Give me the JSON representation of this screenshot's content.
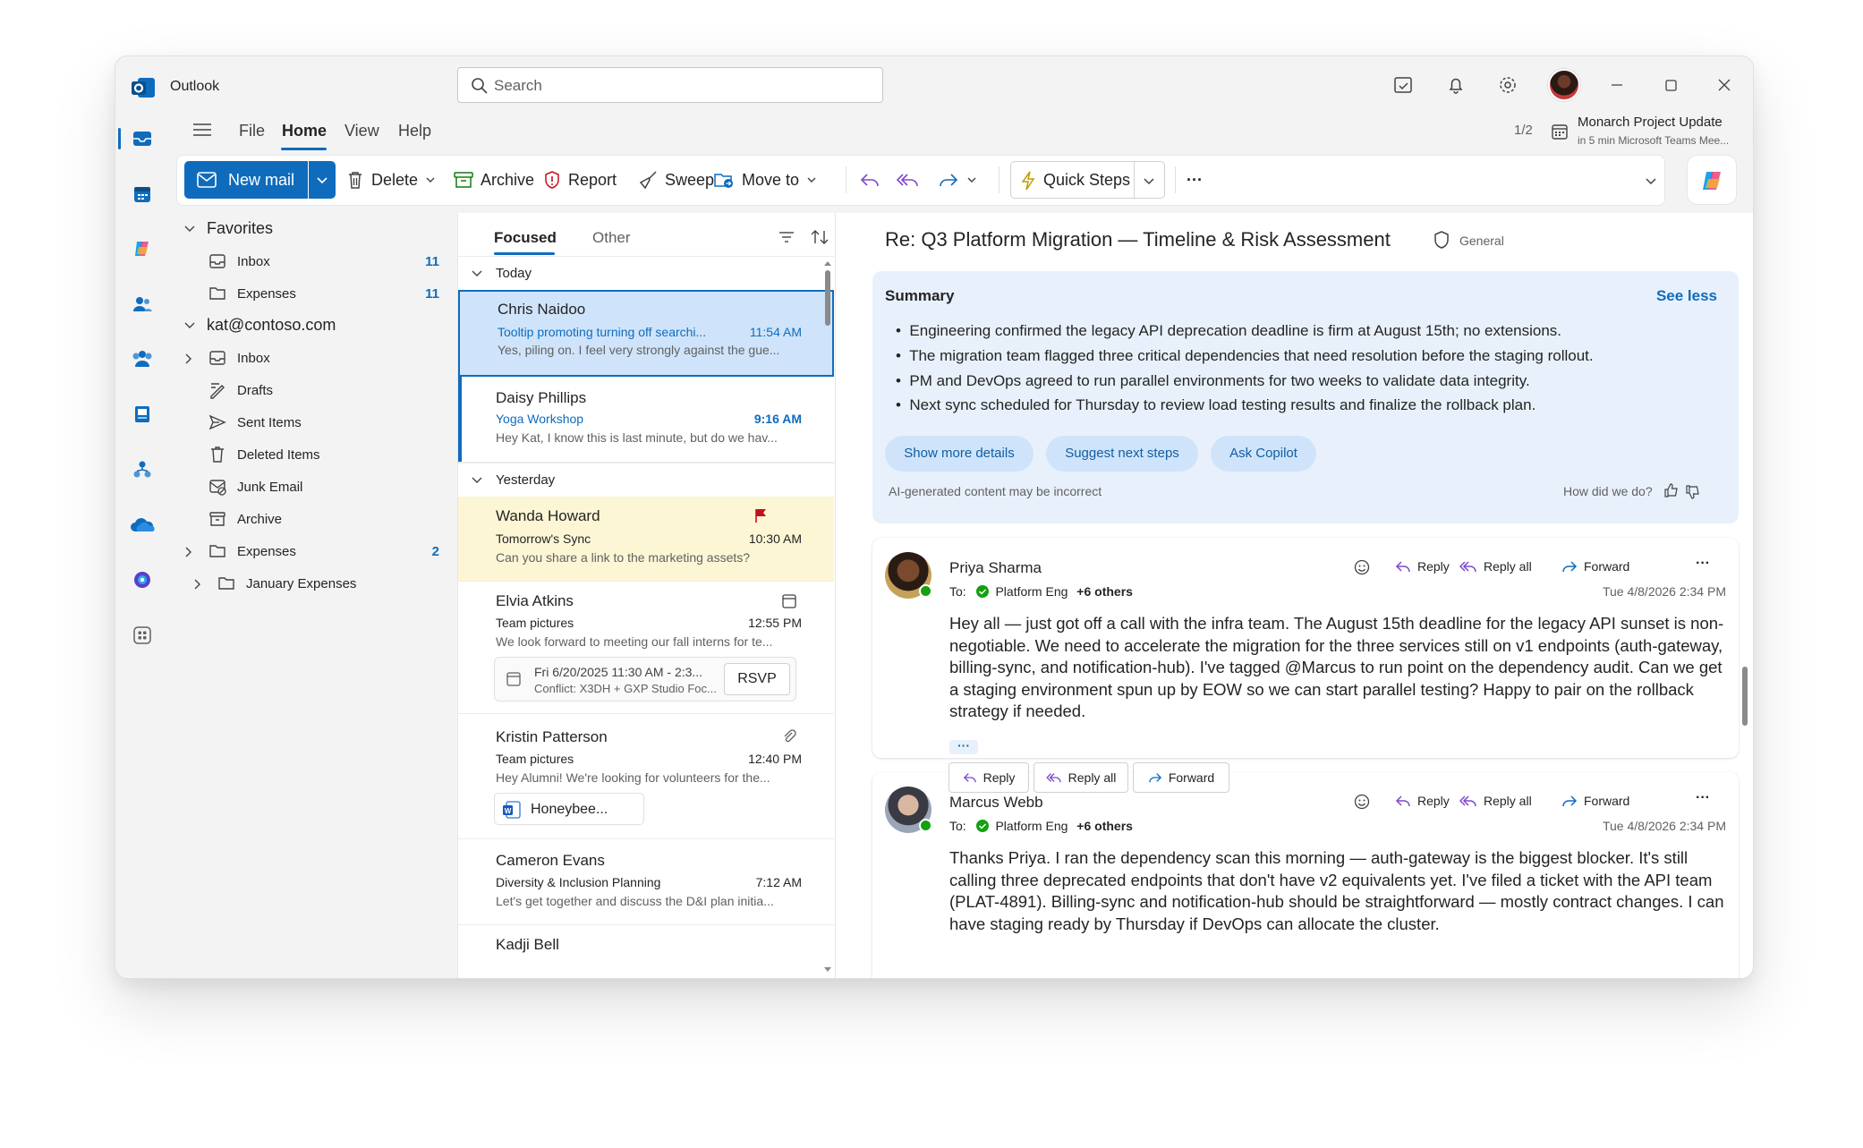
{
  "app": {
    "title": "Outlook"
  },
  "search": {
    "placeholder": "Search"
  },
  "menu": {
    "tabs": [
      "File",
      "Home",
      "View",
      "Help"
    ],
    "active": "Home"
  },
  "meeting": {
    "pager": "1/2",
    "title": "Monarch Project Update",
    "subtitle": "in 5 min Microsoft Teams Mee..."
  },
  "ribbon": {
    "new_mail": "New mail",
    "delete": "Delete",
    "archive": "Archive",
    "report": "Report",
    "sweep": "Sweep",
    "move_to": "Move to",
    "quick_steps": "Quick Steps",
    "more": "···"
  },
  "folders": {
    "favorites_label": "Favorites",
    "favorites": [
      {
        "label": "Inbox",
        "count": "11"
      },
      {
        "label": "Expenses",
        "count": "11"
      }
    ],
    "account_label": "kat@contoso.com",
    "account": [
      {
        "label": "Inbox",
        "count": ""
      },
      {
        "label": "Drafts",
        "count": ""
      },
      {
        "label": "Sent Items",
        "count": ""
      },
      {
        "label": "Deleted Items",
        "count": ""
      },
      {
        "label": "Junk Email",
        "count": ""
      },
      {
        "label": "Archive",
        "count": ""
      },
      {
        "label": "Expenses",
        "count": "2"
      },
      {
        "label": "January Expenses",
        "count": ""
      }
    ]
  },
  "message_list": {
    "tabs": {
      "focused": "Focused",
      "other": "Other"
    },
    "groups": {
      "today": "Today",
      "yesterday": "Yesterday"
    },
    "messages": [
      {
        "sender": "Chris Naidoo",
        "subject": "Tooltip promoting turning off searchi...",
        "time": "11:54 AM",
        "preview": "Yes, piling on. I feel very strongly against the gue..."
      },
      {
        "sender": "Daisy Phillips",
        "subject": "Yoga Workshop",
        "time": "9:16 AM",
        "preview": "Hey Kat, I know this is last minute, but do we hav..."
      },
      {
        "sender": "Wanda Howard",
        "subject": "Tomorrow's Sync",
        "time": "10:30 AM",
        "preview": "Can you share a link to the marketing assets?"
      },
      {
        "sender": "Elvia Atkins",
        "subject": "Team pictures",
        "time": "12:55 PM",
        "preview": "We look forward to meeting our fall interns for te...",
        "invite_line1": "Fri 6/20/2025 11:30 AM - 2:3...",
        "invite_line2": "Conflict: X3DH + GXP Studio Foc...",
        "rsvp": "RSVP"
      },
      {
        "sender": "Kristin Patterson",
        "subject": "Team pictures",
        "time": "12:40 PM",
        "preview": "Hey Alumni! We're looking for volunteers for the...",
        "attachment": "Honeybee..."
      },
      {
        "sender": "Cameron Evans",
        "subject": "Diversity & Inclusion Planning",
        "time": "7:12 AM",
        "preview": "Let's get together and discuss the D&I plan initia..."
      },
      {
        "sender": "Kadji Bell",
        "subject": "",
        "time": "",
        "preview": ""
      }
    ]
  },
  "reading": {
    "subject": "Re: Q3 Platform Migration — Timeline & Risk Assessment",
    "label": "General",
    "summary": {
      "title": "Summary",
      "toggle": "See less",
      "bullets": [
        "Engineering confirmed the legacy API deprecation deadline is firm at August 15th; no extensions.",
        "The migration team flagged three critical dependencies that need resolution before the staging rollout.",
        "PM and DevOps agreed to run parallel environments for two weeks to validate data integrity.",
        "Next sync scheduled for Thursday to review load testing results and finalize the rollback plan."
      ],
      "actions": [
        "Show more details",
        "Suggest next steps",
        "Ask Copilot"
      ],
      "disclaimer": "AI-generated content may be incorrect",
      "feedback": "How did we do?"
    },
    "actions": {
      "reply": "Reply",
      "reply_all": "Reply all",
      "forward": "Forward"
    },
    "messages": [
      {
        "sender": "Priya Sharma",
        "to_prefix": "To:",
        "to": "Platform Eng",
        "others": "+6 others",
        "date": "Tue 4/8/2026 2:34 PM",
        "body": "Hey all — just got off a call with the infra team. The August 15th deadline for the legacy API sunset is non-negotiable. We need to accelerate the migration for the three services still on v1 endpoints (auth-gateway, billing-sync, and notification-hub). I've tagged @Marcus to run point on the dependency audit. Can we get a staging environment spun up by EOW so we can start parallel testing? Happy to pair on the rollback strategy if needed."
      },
      {
        "sender": "Marcus Webb",
        "to_prefix": "To:",
        "to": "Platform Eng",
        "others": "+6 others",
        "date": "Tue 4/8/2026 2:34 PM",
        "body": "Thanks Priya. I ran the dependency scan this morning — auth-gateway is the biggest blocker. It's still calling three deprecated endpoints that don't have v2 equivalents yet. I've filed a ticket with the API team (PLAT-4891). Billing-sync and notification-hub should be straightforward — mostly contract changes. I can have staging ready by Thursday if DevOps can allocate the cluster."
      }
    ]
  },
  "colors": {
    "accent": "#0f6cbd",
    "selected_bg": "#cfe4fa",
    "flagged_bg": "#fdf6d5",
    "summary_bg": "#e8f1fb",
    "flag": "#c50f1f"
  }
}
